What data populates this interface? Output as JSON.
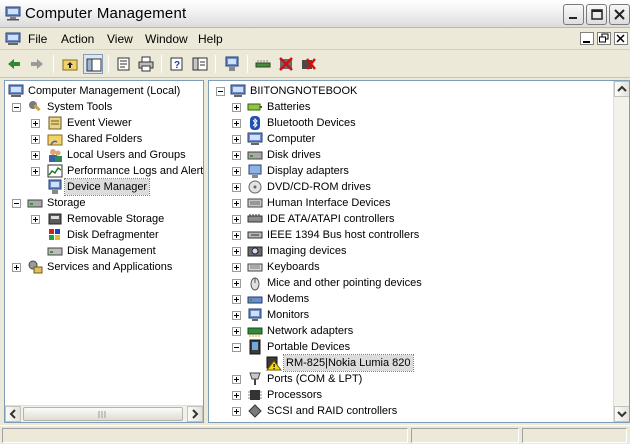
{
  "window": {
    "title": "Computer Management",
    "icon": "computer-management-icon",
    "controls": [
      "minimize-icon",
      "maximize-icon",
      "close-icon"
    ]
  },
  "menu": {
    "items": [
      {
        "label": "File"
      },
      {
        "label": "Action"
      },
      {
        "label": "View"
      },
      {
        "label": "Window"
      },
      {
        "label": "Help"
      }
    ]
  },
  "toolbar": {
    "buttons": [
      "back-arrow-icon",
      "forward-arrow-icon",
      "up-folder-icon",
      "show-hide-tree-icon",
      "properties-icon",
      "print-icon",
      "help-icon",
      "export-list-icon",
      "scan-hardware-icon",
      "update-driver-icon",
      "disable-device-icon",
      "uninstall-device-icon"
    ]
  },
  "left_tree": {
    "root": "Computer Management (Local)",
    "system_tools": "System Tools",
    "event_viewer": "Event Viewer",
    "shared_folders": "Shared Folders",
    "local_users": "Local Users and Groups",
    "perf_logs": "Performance Logs and Alerts",
    "device_manager": "Device Manager",
    "storage": "Storage",
    "removable_storage": "Removable Storage",
    "disk_defrag": "Disk Defragmenter",
    "disk_mgmt": "Disk Management",
    "services_apps": "Services and Applications"
  },
  "device_tree": {
    "computer_name": "BIITONGNOTEBOOK",
    "categories": [
      {
        "label": "Batteries",
        "icon": "battery-icon"
      },
      {
        "label": "Bluetooth Devices",
        "icon": "bluetooth-icon"
      },
      {
        "label": "Computer",
        "icon": "computer-icon"
      },
      {
        "label": "Disk drives",
        "icon": "disk-drive-icon"
      },
      {
        "label": "Display adapters",
        "icon": "display-adapter-icon"
      },
      {
        "label": "DVD/CD-ROM drives",
        "icon": "dvd-drive-icon"
      },
      {
        "label": "Human Interface Devices",
        "icon": "hid-icon"
      },
      {
        "label": "IDE ATA/ATAPI controllers",
        "icon": "ide-controller-icon"
      },
      {
        "label": "IEEE 1394 Bus host controllers",
        "icon": "firewire-icon"
      },
      {
        "label": "Imaging devices",
        "icon": "imaging-device-icon"
      },
      {
        "label": "Keyboards",
        "icon": "keyboard-icon"
      },
      {
        "label": "Mice and other pointing devices",
        "icon": "mouse-icon"
      },
      {
        "label": "Modems",
        "icon": "modem-icon"
      },
      {
        "label": "Monitors",
        "icon": "monitor-icon"
      },
      {
        "label": "Network adapters",
        "icon": "network-adapter-icon"
      },
      {
        "label": "Portable Devices",
        "icon": "portable-device-icon"
      }
    ],
    "portable_child": "RM-825|Nokia Lumia 820",
    "portable_child_icon": "warning-device-icon",
    "more_categories": [
      {
        "label": "Ports (COM & LPT)",
        "icon": "port-icon"
      },
      {
        "label": "Processors",
        "icon": "processor-icon"
      },
      {
        "label": "SCSI and RAID controllers",
        "icon": "scsi-controller-icon"
      }
    ]
  },
  "colors": {
    "selection": "#dcdcdc",
    "pane_border": "#7f9db9",
    "chrome": "#ece9d8",
    "warning": "#ffd800"
  }
}
